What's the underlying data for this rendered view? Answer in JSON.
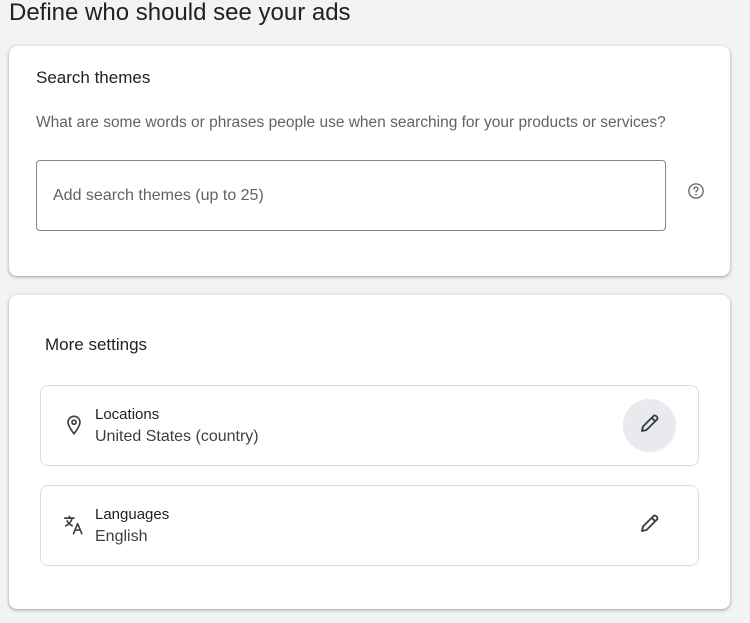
{
  "page": {
    "title": "Define who should see your ads"
  },
  "search_themes": {
    "title": "Search themes",
    "description": "What are some words or phrases people use when searching for your products or services?",
    "input_placeholder": "Add search themes (up to 25)",
    "input_value": "",
    "help_icon": "help-circle-icon"
  },
  "more_settings": {
    "title": "More settings",
    "items": [
      {
        "label": "Locations",
        "value": "United States (country)",
        "icon": "location-pin-icon",
        "edit_icon": "pencil-icon"
      },
      {
        "label": "Languages",
        "value": "English",
        "icon": "translate-icon",
        "edit_icon": "pencil-icon"
      }
    ]
  },
  "colors": {
    "background": "#f1f3f4",
    "card": "#ffffff",
    "text_primary": "#202124",
    "text_secondary": "#5f6368",
    "border": "#dadce0",
    "edit_hover": "#e8eaed"
  }
}
